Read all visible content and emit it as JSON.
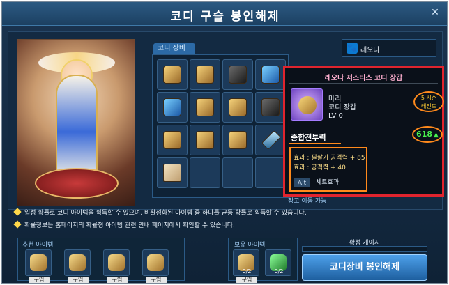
{
  "window": {
    "title": "코디 구슬 봉인해제"
  },
  "equipment": {
    "tab_label": "코디 장비"
  },
  "user": {
    "name": "레오나"
  },
  "tooltip": {
    "title": "레오나 저스티스 코디 장갑",
    "item_info": [
      "마리",
      "코디 장갑",
      "LV 0"
    ],
    "season_lines": [
      "5 시즌",
      "레전드"
    ],
    "combat_power_label": "종합전투력",
    "combat_power_value": "618",
    "effects": [
      "효과 : 필살기 공격력 + 85",
      "효과 : 공격력 + 40"
    ],
    "alt_key": "Alt",
    "set_effect": "세트효과"
  },
  "storage_move": "창고 이동 가능",
  "notices": [
    "일정 확률로 코디 아이템을 획득할 수 있으며, 비활성화된 아이템 중 하나를 균등 확률로 획득할 수 있습니다.",
    "확률정보는 홈페이지의 확률형 아이템 관련 안내 페이지에서 확인할 수 있습니다."
  ],
  "recommended": {
    "label": "추천 아이템",
    "items": [
      {
        "buy": "구입"
      },
      {
        "buy": "구입"
      },
      {
        "buy": "구입"
      },
      {
        "buy": "구입"
      }
    ]
  },
  "owned": {
    "label": "보유 아이템",
    "items": [
      {
        "count": "0/2",
        "buy": "구입"
      },
      {
        "count": "0/2"
      }
    ]
  },
  "gauge": {
    "label": "확정 게이지"
  },
  "unseal_button": "코디장비 봉인해제"
}
